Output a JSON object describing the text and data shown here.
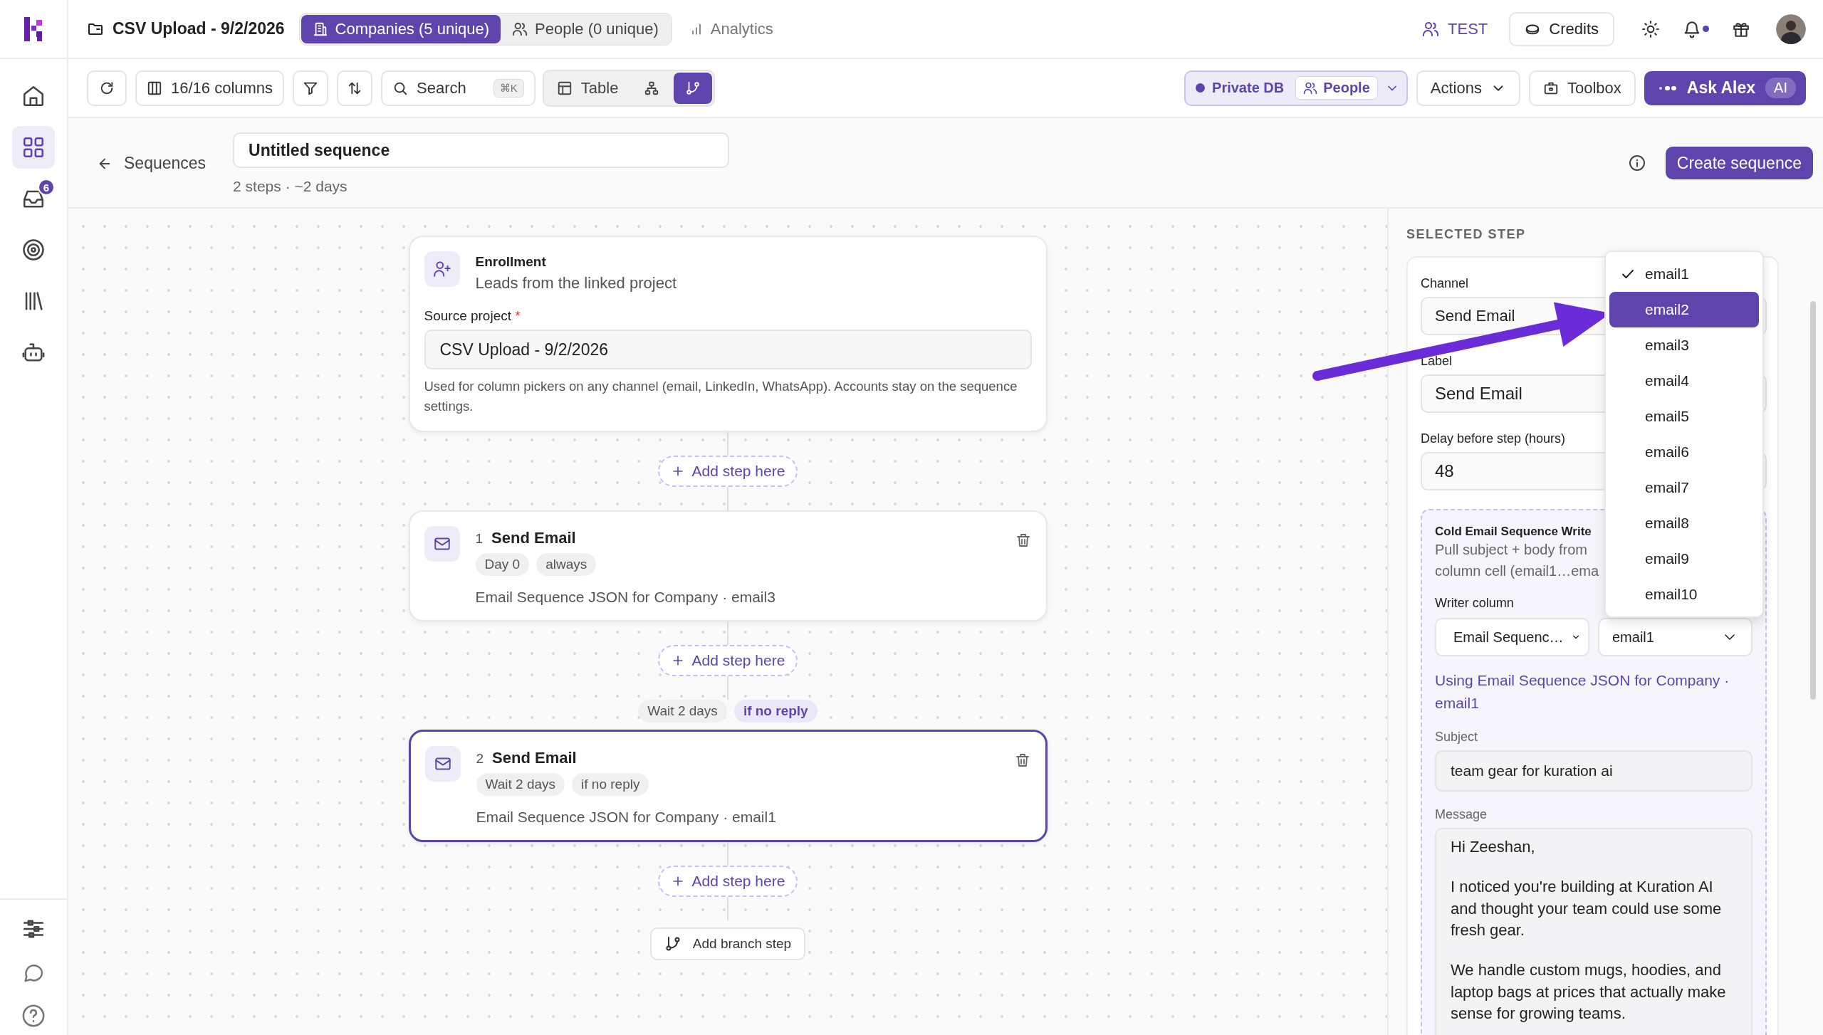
{
  "topbar": {
    "project": "CSV Upload - 9/2/2026",
    "tabs": [
      {
        "label": "Companies (5 unique)",
        "selected": true
      },
      {
        "label": "People (0 unique)",
        "selected": false
      }
    ],
    "analytics": "Analytics",
    "workspace": "TEST",
    "credits": "Credits",
    "notifications_unread": true
  },
  "sidebar": {
    "items": [
      {
        "selected": false
      },
      {
        "selected": true
      },
      {
        "selected": false,
        "badge": "6"
      },
      {
        "selected": false
      },
      {
        "selected": false
      },
      {
        "selected": false
      }
    ]
  },
  "toolbar": {
    "columns": "16/16 columns",
    "search": "Search",
    "shortcut": "⌘K",
    "views": [
      {
        "label": "Table",
        "selected": false
      },
      {
        "selected": false
      },
      {
        "selected": true
      }
    ],
    "database": "Private DB",
    "scope": "People",
    "actions": "Actions",
    "toolbox": "Toolbox",
    "assistant": "Ask Alex",
    "assistant_badge": "AI"
  },
  "sequence": {
    "back": "Sequences",
    "title": "Untitled sequence",
    "summary": "2 steps · ~2 days",
    "create": "Create sequence"
  },
  "flow": [
    {
      "kind": "enrollment",
      "title": "Enrollment",
      "subtitle": "Leads from the linked project",
      "source_label": "Source project",
      "required_mark": "*",
      "source": "CSV Upload - 9/2/2026",
      "help": "Used for column pickers on any channel (email, LinkedIn, WhatsApp). Accounts stay on the sequence settings."
    },
    {
      "kind": "add",
      "label": "Add step here"
    },
    {
      "kind": "step",
      "number": "1",
      "title": "Send Email",
      "chips": [
        "Day 0",
        "always"
      ],
      "source": "Email Sequence JSON for Company · email3",
      "selected": false
    },
    {
      "kind": "add",
      "label": "Add step here"
    },
    {
      "kind": "wait",
      "chips": [
        {
          "label": "Wait 2 days",
          "highlight": false
        },
        {
          "label": "if no reply",
          "highlight": true
        }
      ]
    },
    {
      "kind": "step",
      "number": "2",
      "title": "Send Email",
      "chips": [
        "Wait 2 days",
        "if no reply"
      ],
      "source": "Email Sequence JSON for Company · email1",
      "selected": true
    },
    {
      "kind": "add",
      "label": "Add step here"
    },
    {
      "kind": "branch",
      "label": "Add branch step"
    }
  ],
  "panel": {
    "heading": "SELECTED STEP",
    "channel_label": "Channel",
    "channel": "Send Email",
    "label_label": "Label",
    "label": "Send Email",
    "delay_label": "Delay before step (hours)",
    "delay": "48",
    "writer": {
      "title": "Cold Email Sequence Write",
      "note": [
        "Pull subject + body from",
        "column cell (email1…ema"
      ],
      "column_label": "Writer column",
      "column": "Email Sequenc…",
      "email": "email1",
      "using": "Using Email Sequence JSON for Company · email1",
      "subject_label": "Subject",
      "subject": "team gear for kuration ai",
      "message_label": "Message",
      "message": [
        "Hi Zeeshan,",
        "I noticed you're building at Kuration AI and thought your team could use some fresh gear.",
        "We handle custom mugs, hoodies, and laptop bags at prices that actually make sense for growing teams."
      ]
    }
  },
  "dropdown": {
    "options": [
      {
        "label": "email1",
        "checked": true,
        "selected": false
      },
      {
        "label": "email2",
        "checked": false,
        "selected": true
      },
      {
        "label": "email3",
        "checked": false,
        "selected": false
      },
      {
        "label": "email4",
        "checked": false,
        "selected": false
      },
      {
        "label": "email5",
        "checked": false,
        "selected": false
      },
      {
        "label": "email6",
        "checked": false,
        "selected": false
      },
      {
        "label": "email7",
        "checked": false,
        "selected": false
      },
      {
        "label": "email8",
        "checked": false,
        "selected": false
      },
      {
        "label": "email9",
        "checked": false,
        "selected": false
      },
      {
        "label": "email10",
        "checked": false,
        "selected": false
      }
    ]
  }
}
